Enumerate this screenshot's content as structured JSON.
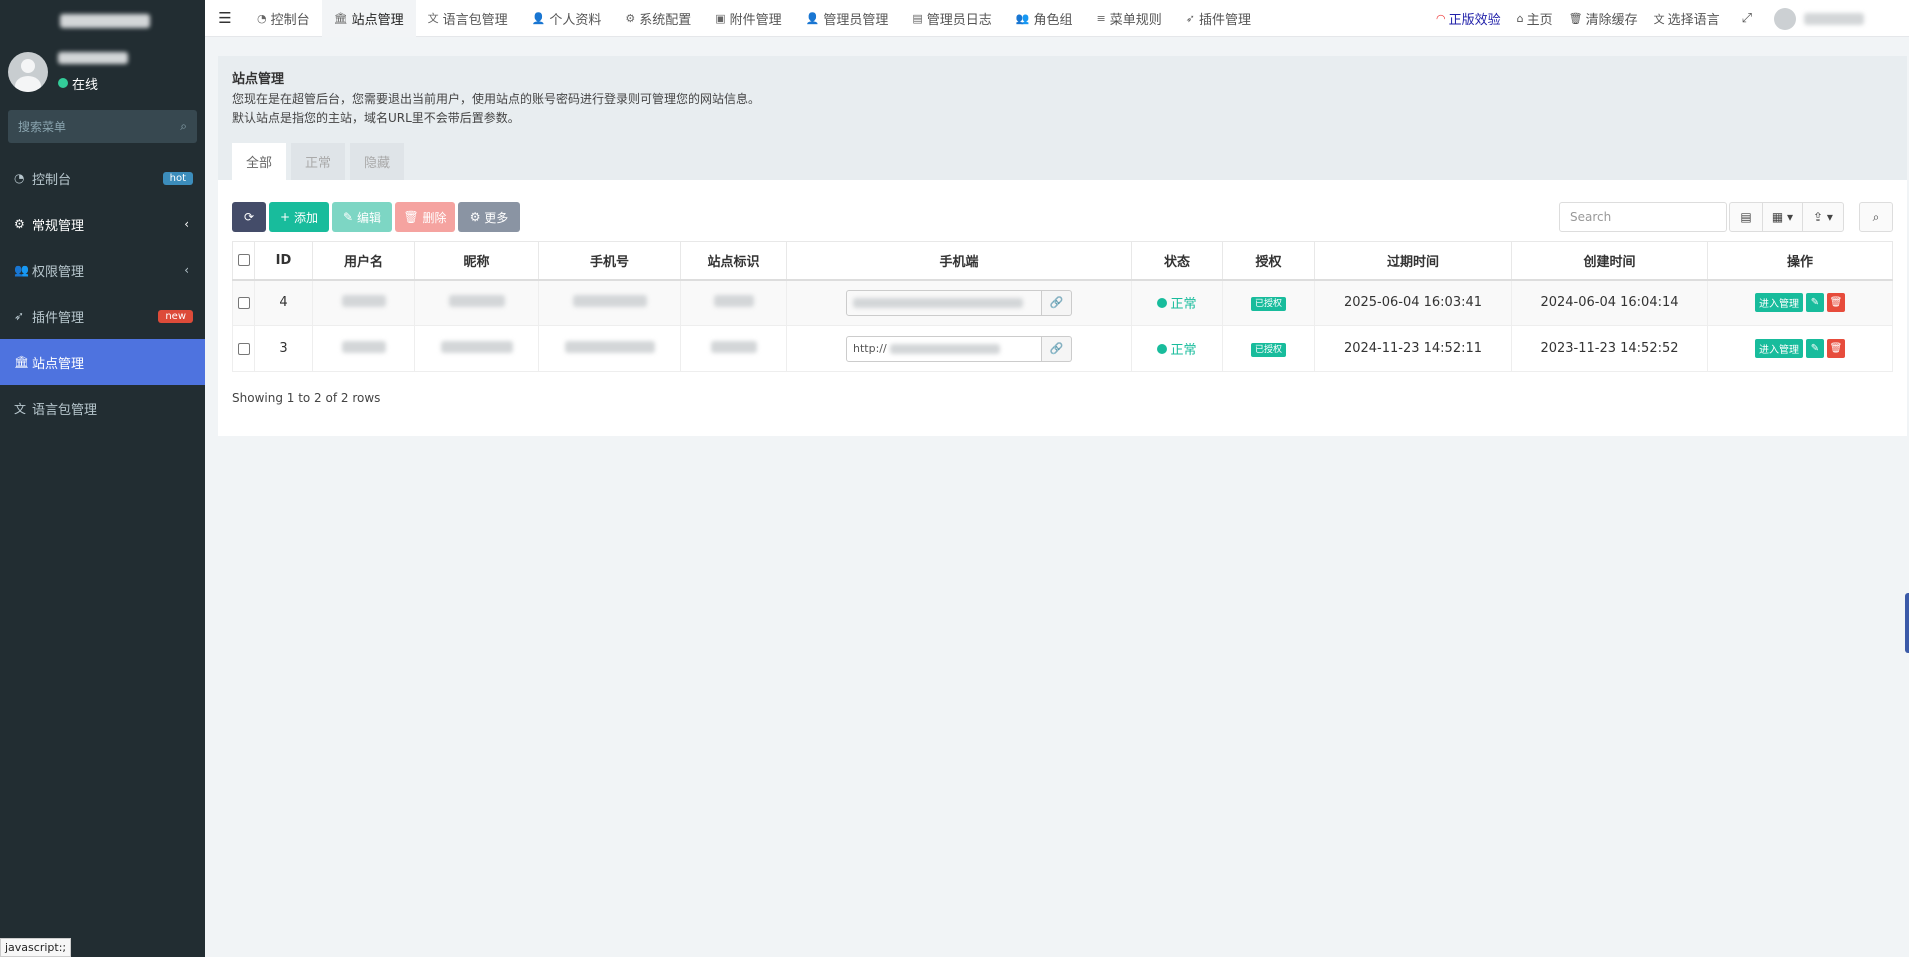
{
  "sidebar": {
    "user_status": "在线",
    "search_placeholder": "搜索菜单",
    "items": [
      {
        "label": "控制台",
        "icon": "dashboard-icon",
        "badge": "hot",
        "badge_color": "#3c8dbc"
      },
      {
        "label": "常规管理",
        "icon": "cogs-icon",
        "arrow": "‹"
      },
      {
        "label": "权限管理",
        "icon": "users-icon",
        "arrow": "‹"
      },
      {
        "label": "插件管理",
        "icon": "rocket-icon",
        "badge": "new",
        "badge_color": "#dd4b39"
      },
      {
        "label": "站点管理",
        "icon": "bank-icon"
      },
      {
        "label": "语言包管理",
        "icon": "language-icon"
      }
    ]
  },
  "topnav": {
    "tabs": [
      "控制台",
      "站点管理",
      "语言包管理",
      "个人资料",
      "系统配置",
      "附件管理",
      "管理员管理",
      "管理员日志",
      "角色组",
      "菜单规则",
      "插件管理"
    ],
    "right": {
      "genuine": "正版效验",
      "home": "主页",
      "clear_cache": "清除缓存",
      "language": "选择语言"
    }
  },
  "panel": {
    "title": "站点管理",
    "desc_line1": "您现在是在超管后台，您需要退出当前用户，使用站点的账号密码进行登录则可管理您的网站信息。",
    "desc_line2": "默认站点是指您的主站，域名URL里不会带后置参数。",
    "subtabs": [
      "全部",
      "正常",
      "隐藏"
    ]
  },
  "toolbar": {
    "add": "添加",
    "edit": "编辑",
    "delete": "删除",
    "more": "更多",
    "search_placeholder": "Search"
  },
  "table": {
    "headers": [
      "ID",
      "用户名",
      "昵称",
      "手机号",
      "站点标识",
      "手机端",
      "状态",
      "授权",
      "过期时间",
      "创建时间",
      "操作"
    ],
    "rows": [
      {
        "id": "4",
        "status": "正常",
        "auth": "已授权",
        "expire": "2025-06-04 16:03:41",
        "created": "2024-06-04 16:04:14",
        "op_enter": "进入管理"
      },
      {
        "id": "3",
        "mobile_prefix": "http://",
        "status": "正常",
        "auth": "已授权",
        "expire": "2024-11-23 14:52:11",
        "created": "2023-11-23 14:52:52",
        "op_enter": "进入管理"
      }
    ]
  },
  "pagination": "Showing 1 to 2 of 2 rows",
  "statusbar": "javascript:;"
}
